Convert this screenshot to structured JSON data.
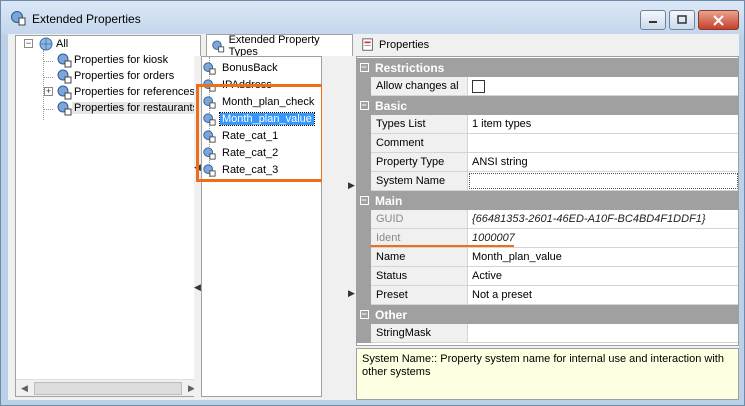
{
  "window": {
    "title": "Extended Properties",
    "icon": "extended-properties-icon",
    "controls": {
      "minimize": "–",
      "maximize": "□",
      "close": "✕"
    }
  },
  "tree": {
    "root_label": "All",
    "expand_marker": "+",
    "collapse_marker": "−",
    "items": [
      {
        "label": "Properties for kiosk"
      },
      {
        "label": "Properties for orders"
      },
      {
        "label": "Properties for references"
      },
      {
        "label": "Properties for restaurants"
      }
    ],
    "scroll_left": "◀",
    "scroll_right": "▶"
  },
  "tabs": [
    {
      "label": "Extended Property Types"
    },
    {
      "label": "Properties"
    }
  ],
  "splitters": {
    "left_arrow": "◀",
    "right_arrow": "▶"
  },
  "type_list": {
    "items": [
      {
        "label": "BonusBack"
      },
      {
        "label": "IPAddress"
      },
      {
        "label": "Month_plan_check"
      },
      {
        "label": "Month_plan_value"
      },
      {
        "label": "Rate_cat_1"
      },
      {
        "label": "Rate_cat_2"
      },
      {
        "label": "Rate_cat_3"
      }
    ],
    "selected_index": 3
  },
  "grid": {
    "categories": {
      "restrictions": "Restrictions",
      "basic": "Basic",
      "main": "Main",
      "other": "Other"
    },
    "toggle_symbol": "−",
    "rows": {
      "allow_changes": {
        "name": "Allow changes al",
        "value": ""
      },
      "types_list": {
        "name": "Types List",
        "value": "1 item types"
      },
      "comment": {
        "name": "Comment",
        "value": ""
      },
      "property_type": {
        "name": "Property Type",
        "value": "ANSI string"
      },
      "system_name": {
        "name": "System Name",
        "value": ""
      },
      "guid": {
        "name": "GUID",
        "value": "{66481353-2601-46ED-A10F-BC4BD4F1DDF1}"
      },
      "ident": {
        "name": "Ident",
        "value": "1000007"
      },
      "name": {
        "name": "Name",
        "value": "Month_plan_value"
      },
      "status": {
        "name": "Status",
        "value": "Active"
      },
      "preset": {
        "name": "Preset",
        "value": "Not a preset"
      },
      "string_mask": {
        "name": "StringMask",
        "value": ""
      }
    }
  },
  "help": {
    "text": "System Name:: Property system name for internal use and interaction with other systems"
  },
  "colors": {
    "highlight": "#ef6e1c",
    "selection": "#3399ff",
    "category": "#a0a0a0",
    "help_bg": "#ffffe1"
  }
}
